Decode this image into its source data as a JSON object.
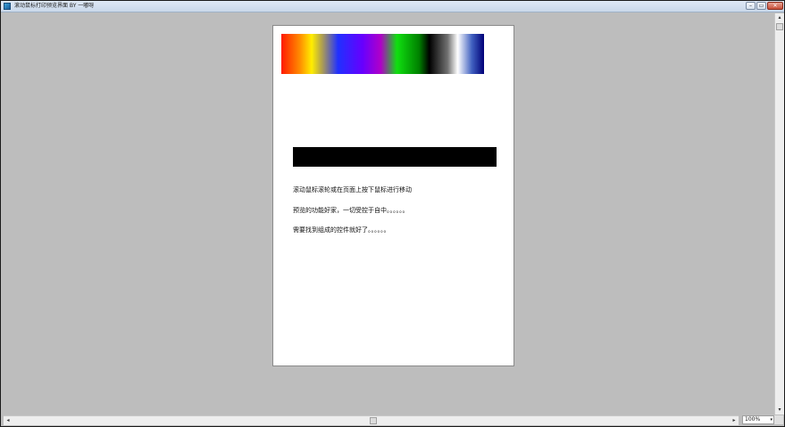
{
  "window": {
    "title": "滚动鼠标打印预览界面  BY 一嘟呀",
    "buttons": {
      "minimize": "–",
      "maximize": "▭",
      "close": "✕"
    }
  },
  "page": {
    "notes": [
      "滚动鼠标滚轮或在页面上按下鼠标进行移动",
      "预览的功能好家，一切受控于自中。。。。。。",
      "需要找到组成的控件就好了。。。。。。"
    ]
  },
  "scrollbars": {
    "left_arrow": "◂",
    "right_arrow": "▸",
    "up_arrow": "▴",
    "down_arrow": "▾"
  },
  "zoom": {
    "value": "100%"
  },
  "icons": {
    "app": "app-icon"
  }
}
